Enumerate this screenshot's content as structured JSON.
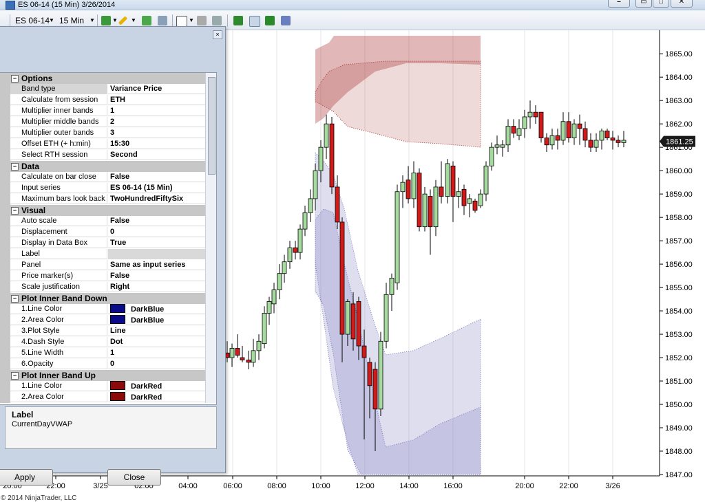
{
  "window": {
    "title": "ES 06-14 (15 Min)  3/26/2014"
  },
  "toolbar": {
    "instrument": "ES 06-14",
    "interval": "15 Min"
  },
  "chart": {
    "last_price": "1861.25",
    "y_ticks": [
      "1865.00",
      "1864.00",
      "1863.00",
      "1862.00",
      "1861.00",
      "1860.00",
      "1859.00",
      "1858.00",
      "1857.00",
      "1856.00",
      "1855.00",
      "1854.00",
      "1853.00",
      "1852.00",
      "1851.00",
      "1850.00",
      "1849.00",
      "1848.00",
      "1847.00"
    ],
    "x_ticks": [
      "20:00",
      "22:00",
      "3/25",
      "02:00",
      "04:00",
      "06:00",
      "08:00",
      "10:00",
      "12:00",
      "14:00",
      "16:00",
      "20:00",
      "22:00",
      "3/26"
    ],
    "colors": {
      "up": "#a6dba0",
      "down": "#d11a1a",
      "upper_band": "#a83232",
      "lower_band": "#7b7bc0"
    }
  },
  "chart_data": {
    "type": "candlestick",
    "ylim": [
      1847,
      1865.3
    ],
    "y_ticks_values": [
      1865,
      1864,
      1863,
      1862,
      1861,
      1860,
      1859,
      1858,
      1857,
      1856,
      1855,
      1854,
      1853,
      1852,
      1851,
      1850,
      1849,
      1848,
      1847
    ],
    "last": 1861.25
  },
  "dialog": {
    "categories": [
      {
        "label": "Options",
        "rows": [
          {
            "name": "Band type",
            "value": "Variance  Price"
          },
          {
            "name": "Calculate from session",
            "value": "ETH"
          },
          {
            "name": "Multiplier inner bands",
            "value": "1"
          },
          {
            "name": "Multiplier middle bands",
            "value": "2"
          },
          {
            "name": "Multiplier outer bands",
            "value": "3"
          },
          {
            "name": "Offset ETH (+ h:min)",
            "value": "15:30"
          },
          {
            "name": "Select RTH session",
            "value": "Second"
          }
        ]
      },
      {
        "label": "Data",
        "rows": [
          {
            "name": "Calculate on bar close",
            "value": "False"
          },
          {
            "name": "Input series",
            "value": "ES 06-14 (15 Min)"
          },
          {
            "name": "Maximum bars look back",
            "value": "TwoHundredFiftySix"
          }
        ]
      },
      {
        "label": "Visual",
        "rows": [
          {
            "name": "Auto scale",
            "value": "False"
          },
          {
            "name": "Displacement",
            "value": "0"
          },
          {
            "name": "Display in Data Box",
            "value": "True"
          },
          {
            "name": "Label",
            "value": ""
          },
          {
            "name": "Panel",
            "value": "Same as input series"
          },
          {
            "name": "Price marker(s)",
            "value": "False"
          },
          {
            "name": "Scale justification",
            "value": "Right"
          }
        ]
      },
      {
        "label": "Plot Inner Band Down",
        "rows": [
          {
            "name": "1.Line Color",
            "value": "DarkBlue",
            "swatch": "#0b0b8a"
          },
          {
            "name": "2.Area Color",
            "value": "DarkBlue",
            "swatch": "#0b0b8a"
          },
          {
            "name": "3.Plot Style",
            "value": "Line"
          },
          {
            "name": "4.Dash Style",
            "value": "Dot"
          },
          {
            "name": "5.Line Width",
            "value": "1"
          },
          {
            "name": "6.Opacity",
            "value": "0"
          }
        ]
      },
      {
        "label": "Plot Inner Band Up",
        "rows": [
          {
            "name": "1.Line Color",
            "value": "DarkRed",
            "swatch": "#8b0a0a"
          },
          {
            "name": "2.Area Color",
            "value": "DarkRed",
            "swatch": "#8b0a0a"
          }
        ]
      }
    ],
    "description": {
      "title": "Label",
      "text": "CurrentDayVWAP"
    },
    "apply_label": "Apply",
    "close_label": "Close",
    "copyright": "© 2014 NinjaTrader, LLC",
    "collapse_glyph": "−",
    "close_glyph": "×"
  }
}
